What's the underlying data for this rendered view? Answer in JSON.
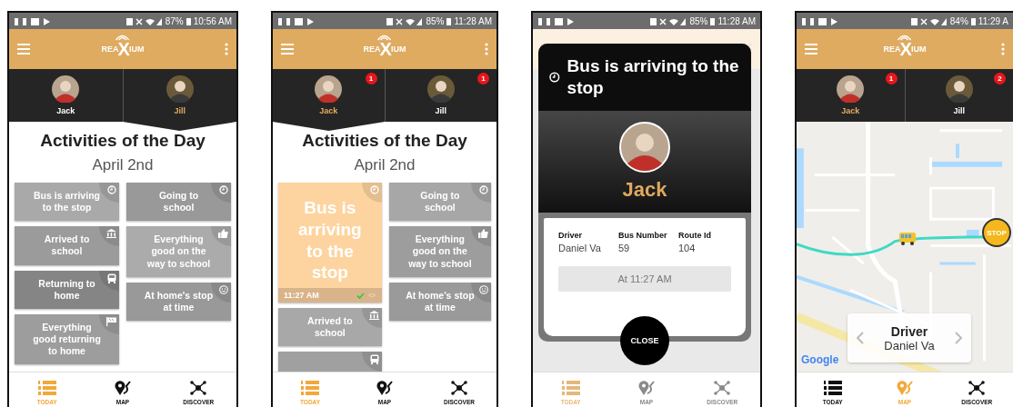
{
  "screens": [
    {
      "kind": "activities",
      "status": {
        "battery": "87%",
        "time": "10:56 AM"
      },
      "logo": {
        "left": "REA",
        "mark": "X",
        "right": "IUM"
      },
      "kids": [
        {
          "name": "Jack",
          "selected": false
        },
        {
          "name": "Jill",
          "selected": true
        }
      ],
      "title": "Activities of the Day",
      "date": "April 2nd",
      "columns": [
        [
          {
            "kind": "clock",
            "label": "Bus is arriving to the stop",
            "color": "#a9a9a9",
            "expanded": false
          },
          {
            "kind": "school",
            "label": "Arrived to school",
            "color": "#9b9b9b",
            "expanded": false
          },
          {
            "kind": "bus",
            "label": "Returning to home",
            "color": "#858585",
            "expanded": false
          },
          {
            "kind": "flag",
            "label": "Everything good returning to home",
            "color": "#9d9d9d",
            "expanded": false
          }
        ],
        [
          {
            "kind": "clock",
            "label": "Going to school",
            "color": "#999999",
            "expanded": false
          },
          {
            "kind": "thumb",
            "label": "Everything good on the way to school",
            "color": "#ababab",
            "expanded": false
          },
          {
            "kind": "smile",
            "label": "At home's stop at time",
            "color": "#999999",
            "expanded": false
          }
        ]
      ],
      "nav": [
        {
          "kind": "list",
          "label": "TODAY",
          "selected": true
        },
        {
          "kind": "pin",
          "label": "MAP",
          "selected": false
        },
        {
          "kind": "network",
          "label": "DISCOVER",
          "selected": false
        }
      ]
    },
    {
      "kind": "activities",
      "status": {
        "battery": "85%",
        "time": "11:28 AM"
      },
      "logo": {
        "left": "REA",
        "mark": "X",
        "right": "IUM"
      },
      "kids": [
        {
          "name": "Jack",
          "selected": true,
          "badge": "1"
        },
        {
          "name": "Jill",
          "selected": false,
          "badge": "1"
        }
      ],
      "title": "Activities of the Day",
      "date": "April 2nd",
      "columns": [
        [
          {
            "kind": "clock",
            "label": "Bus is arriving to the stop",
            "color": "#fdd4a0",
            "expanded": true,
            "time": "11:27 AM"
          },
          {
            "kind": "school",
            "label": "Arrived to school",
            "color": "#a8a8a8",
            "expanded": false
          },
          {
            "kind": "bus",
            "color": "#a0a0a0",
            "expanded": false
          }
        ],
        [
          {
            "kind": "clock",
            "label": "Going to school",
            "color": "#a7a7a7",
            "expanded": false
          },
          {
            "kind": "thumb",
            "label": "Everything good on the way to school",
            "color": "#9d9d9d",
            "expanded": false
          },
          {
            "kind": "smile",
            "label": "At home's stop at time",
            "color": "#9a9a9a",
            "expanded": false
          }
        ]
      ],
      "nav": [
        {
          "kind": "list",
          "label": "TODAY",
          "selected": true
        },
        {
          "kind": "pin",
          "label": "MAP",
          "selected": false
        },
        {
          "kind": "network",
          "label": "DISCOVER",
          "selected": false
        }
      ]
    },
    {
      "kind": "dialog",
      "status": {
        "battery": "85%",
        "time": "11:28 AM"
      },
      "dialog": {
        "title": "Bus is arriving to the stop",
        "name": "Jack",
        "fields": [
          {
            "label": "Driver",
            "value": "Daniel Va"
          },
          {
            "label": "Bus Number",
            "value": "59"
          },
          {
            "label": "Route Id",
            "value": "104"
          }
        ],
        "time": "At 11:27 AM",
        "close": "CLOSE"
      },
      "nav": [
        {
          "kind": "list",
          "label": "TODAY",
          "selected": true
        },
        {
          "kind": "pin",
          "label": "MAP",
          "selected": false
        },
        {
          "kind": "network",
          "label": "DISCOVER",
          "selected": false
        }
      ]
    },
    {
      "kind": "map",
      "status": {
        "battery": "84%",
        "time": "11:29 A"
      },
      "logo": {
        "left": "REA",
        "mark": "X",
        "right": "IUM"
      },
      "kids": [
        {
          "name": "Jack",
          "selected": true,
          "badge": "1"
        },
        {
          "name": "Jill",
          "selected": false,
          "badge": "2"
        }
      ],
      "map": {
        "stop": "STOP",
        "attribution": "Google",
        "card_label": "Driver",
        "card_value": "Daniel Va"
      },
      "nav": [
        {
          "kind": "list",
          "label": "TODAY",
          "selected": false
        },
        {
          "kind": "pin",
          "label": "MAP",
          "selected": true
        },
        {
          "kind": "network",
          "label": "DISCOVER",
          "selected": false
        }
      ]
    }
  ]
}
